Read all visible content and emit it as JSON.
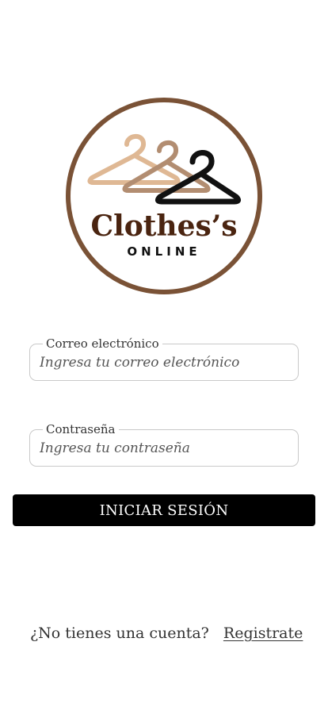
{
  "logo": {
    "brand": "Clothes’s",
    "subtitle": "ONLINE",
    "ring_color": "#7a5236",
    "hanger_colors": [
      "#dfb894",
      "#b28d71",
      "#111111"
    ],
    "brand_color": "#4a2410"
  },
  "email": {
    "label": "Correo electrónico",
    "placeholder": "Ingresa tu correo electrónico",
    "value": ""
  },
  "password": {
    "label": "Contraseña",
    "placeholder": "Ingresa tu contraseña",
    "value": ""
  },
  "login_button": {
    "label": "INICIAR SESIÓN",
    "color": "#000000"
  },
  "footer": {
    "question": "¿No tienes una cuenta?",
    "register_link": "Registrate"
  }
}
